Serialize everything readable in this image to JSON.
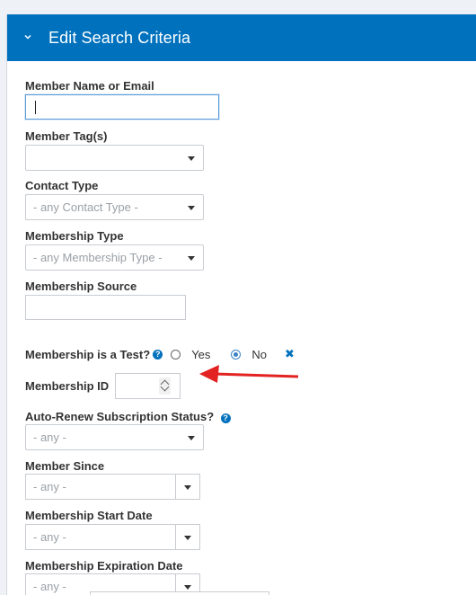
{
  "header": {
    "title": "Edit Search Criteria",
    "chevron_icon": "chevron-down-icon",
    "bg_color": "#0071bd"
  },
  "fields": {
    "member_name": {
      "label": "Member Name or Email",
      "value": ""
    },
    "member_tags": {
      "label": "Member Tag(s)",
      "value": ""
    },
    "contact_type": {
      "label": "Contact Type",
      "placeholder": "- any Contact Type -"
    },
    "membership_type": {
      "label": "Membership Type",
      "placeholder": "- any Membership Type -"
    },
    "membership_source": {
      "label": "Membership Source",
      "value": ""
    },
    "is_test": {
      "label": "Membership is a Test?",
      "help_icon": "?",
      "options": [
        "Yes",
        "No"
      ],
      "selected": "No",
      "clear_icon": "✖"
    },
    "membership_id": {
      "label": "Membership ID",
      "value": ""
    },
    "auto_renew": {
      "label": "Auto-Renew Subscription Status?",
      "help_icon": "?",
      "placeholder": "- any -"
    },
    "member_since": {
      "label": "Member Since",
      "placeholder": "- any -"
    },
    "start_date": {
      "label": "Membership Start Date",
      "placeholder": "- any -"
    },
    "expiration_date": {
      "label": "Membership Expiration Date",
      "placeholder": "- any -"
    }
  },
  "colors": {
    "accent": "#0071bd",
    "annotation_arrow": "#e32222"
  }
}
